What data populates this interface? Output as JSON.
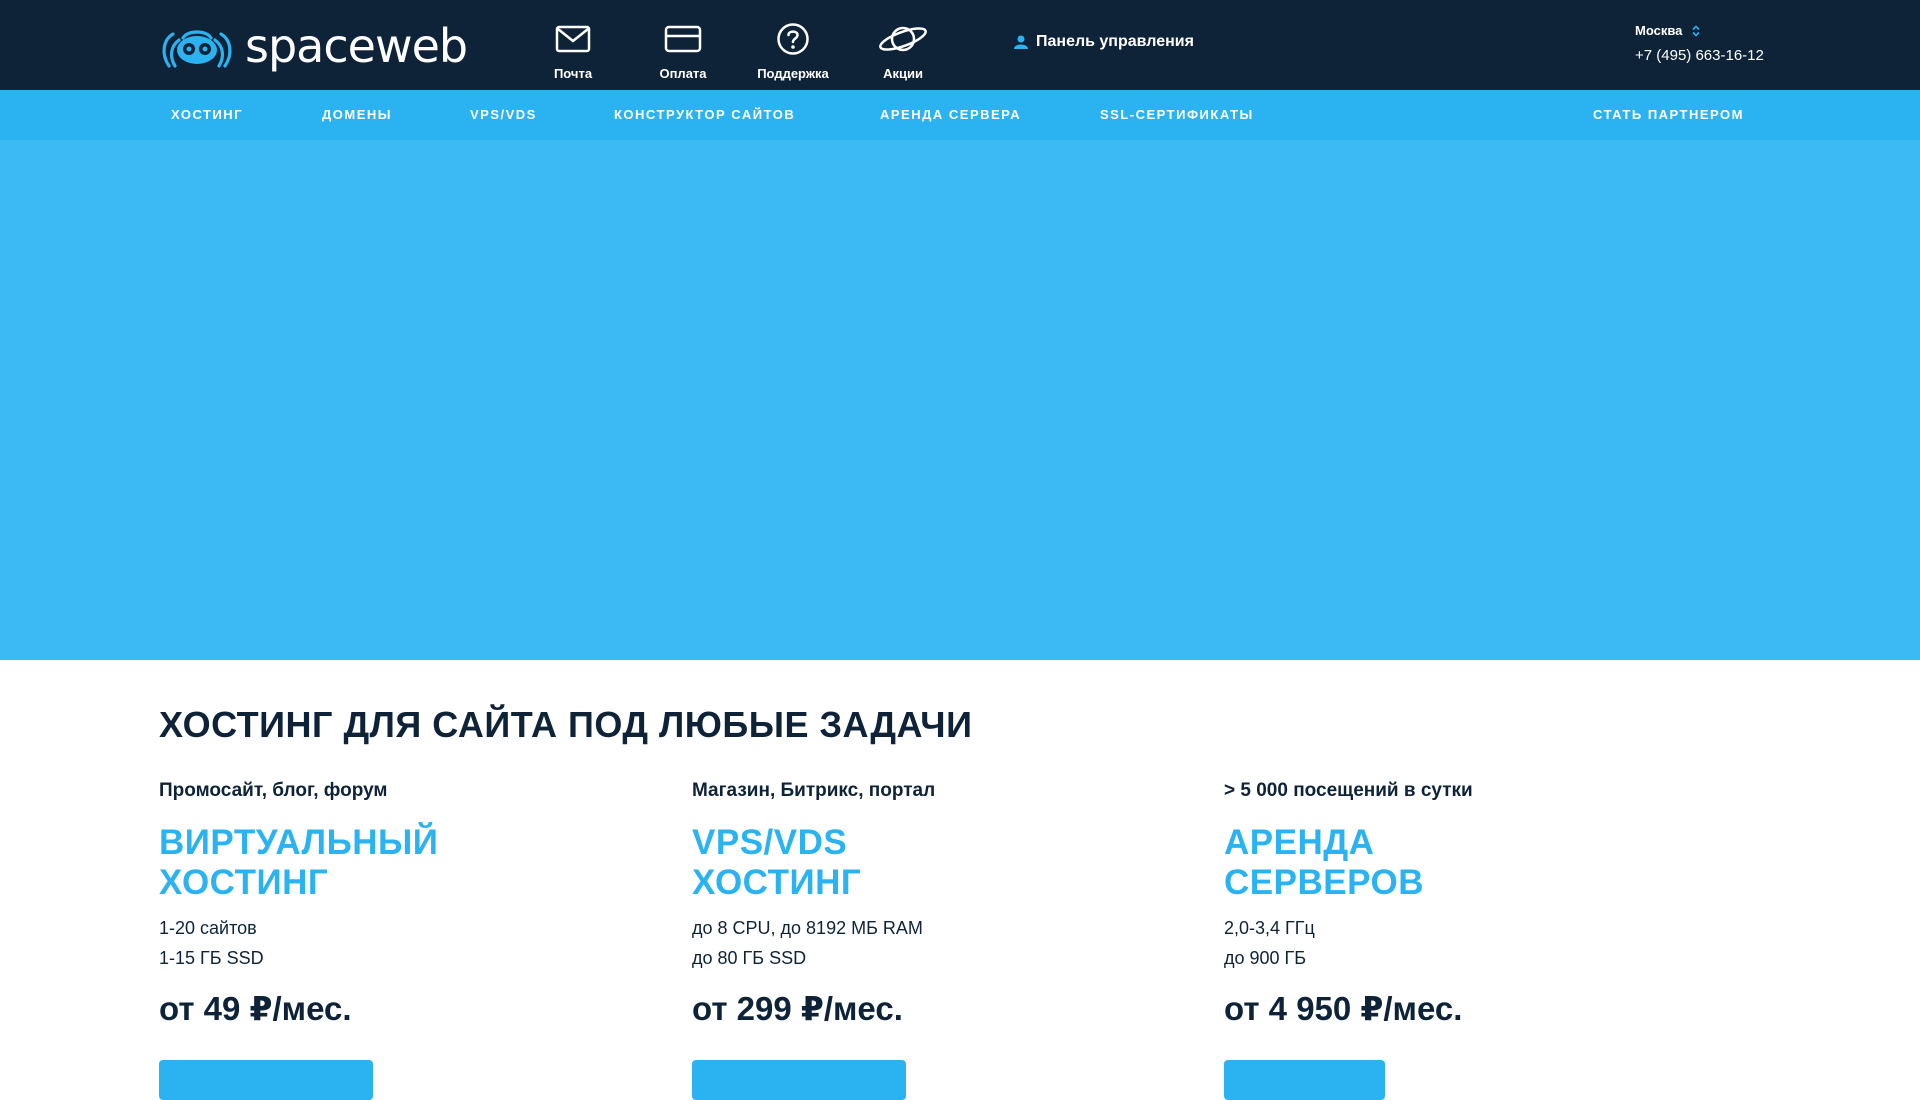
{
  "header": {
    "logo_text": "spaceweb",
    "quick_links": [
      {
        "label": "Почта",
        "icon": "mail-icon"
      },
      {
        "label": "Оплата",
        "icon": "card-icon"
      },
      {
        "label": "Поддержка",
        "icon": "question-icon"
      },
      {
        "label": "Акции",
        "icon": "planet-icon"
      }
    ],
    "control_panel_label": "Панель управления",
    "city": "Москва",
    "phone": "+7 (495) 663-16-12"
  },
  "nav": {
    "items": [
      "ХОСТИНГ",
      "ДОМЕНЫ",
      "VPS/VDS",
      "КОНСТРУКТОР САЙТОВ",
      "АРЕНДА СЕРВЕРА",
      "SSL-СЕРТИФИКАТЫ"
    ],
    "partner": "СТАТЬ ПАРТНЕРОМ"
  },
  "main": {
    "title": "ХОСТИНГ ДЛЯ САЙТА ПОД ЛЮБЫЕ ЗАДАЧИ",
    "plans": [
      {
        "subtitle": "Промосайт, блог, форум",
        "name_line1": "ВИРТУАЛЬНЫЙ",
        "name_line2": "ХОСТИНГ",
        "spec1": "1-20 сайтов",
        "spec2": "1-15 ГБ SSD",
        "price": "от 49 ₽/мес."
      },
      {
        "subtitle": "Магазин, Битрикс, портал",
        "name_line1": "VPS/VDS",
        "name_line2": "ХОСТИНГ",
        "spec1": "до 8 CPU, до 8192 МБ RAM",
        "spec2": "до 80 ГБ SSD",
        "price": "от 299 ₽/мес."
      },
      {
        "subtitle": "> 5 000 посещений в сутки",
        "name_line1": "АРЕНДА",
        "name_line2": "СЕРВЕРОВ",
        "spec1": "2,0-3,4 ГГц",
        "spec2": "до 900 ГБ",
        "price": "от 4 950 ₽/мес."
      }
    ]
  },
  "colors": {
    "header_bg": "#0e2338",
    "nav_bg": "#2bb3f1",
    "hero_bg": "#3bbaf3",
    "accent": "#2bb3f1"
  }
}
